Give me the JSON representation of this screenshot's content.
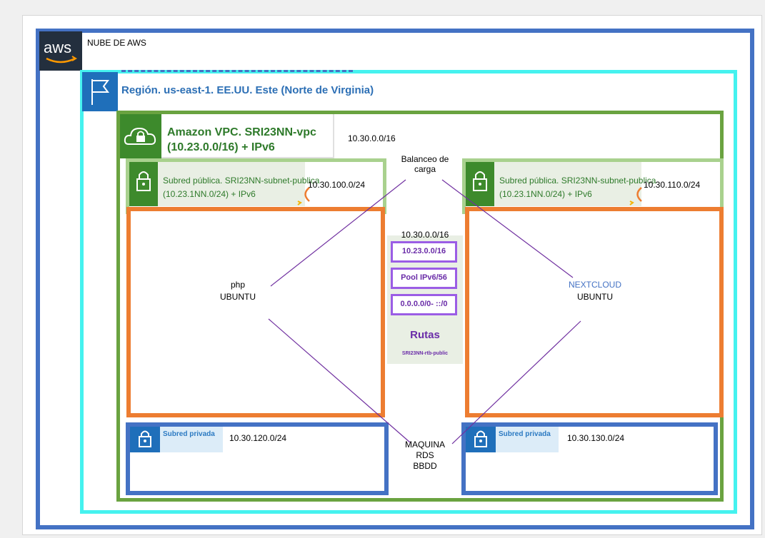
{
  "cloud": {
    "label": "NUBE DE AWS",
    "logo_text": "aws"
  },
  "region": {
    "title": "Región. us-east-1. EE.UU. Este (Norte de Virginia)"
  },
  "vpc": {
    "title_line1": "Amazon VPC. SRI23NN-vpc",
    "title_line2": "(10.23.0.0/16) + IPv6",
    "cidr": "10.30.0.0/16"
  },
  "load_balancer": {
    "line1": "Balanceo de",
    "line2": "carga"
  },
  "subnets_public": [
    {
      "title_line1": "Subred pública. SRI23NN-subnet-publica",
      "title_line2": "(10.23.1NN.0/24) + IPv6",
      "cidr": "10.30.100.0/24"
    },
    {
      "title_line1": "Subred pública. SRI23NN-subnet-publica",
      "title_line2": "(10.23.1NN.0/24) + IPv6",
      "cidr": "10.30.110.0/24"
    }
  ],
  "instances": [
    {
      "line1": "php",
      "line2": "UBUNTU"
    },
    {
      "line1": "NEXTCLOUD",
      "line2": "UBUNTU"
    }
  ],
  "route_table": {
    "cidr": "10.30.0.0/16",
    "routes": [
      "10.23.0.0/16",
      "Pool IPv6/56",
      "0.0.0.0/0- ::/0"
    ],
    "title": "Rutas",
    "name": "SRI23NN-rtb-public"
  },
  "subnets_private": [
    {
      "tag": "Subred privada",
      "cidr": "10.30.120.0/24"
    },
    {
      "tag": "Subred privada",
      "cidr": "10.30.130.0/24"
    }
  ],
  "database": {
    "line1": "MAQUINA",
    "line2": "RDS",
    "line3": "BBDD"
  },
  "colors": {
    "cloud_border": "#4472c4",
    "region_border": "#45f2ef",
    "vpc_border": "#6aa340",
    "public_subnet_border": "#a9d18e",
    "instance_border": "#ed7d31",
    "private_subnet_border": "#4472c4",
    "connector": "#7030a0",
    "route_border": "#9b5de5"
  },
  "icons": [
    "aws-logo",
    "flag-icon",
    "cloud-lock-icon",
    "lock-icon"
  ]
}
